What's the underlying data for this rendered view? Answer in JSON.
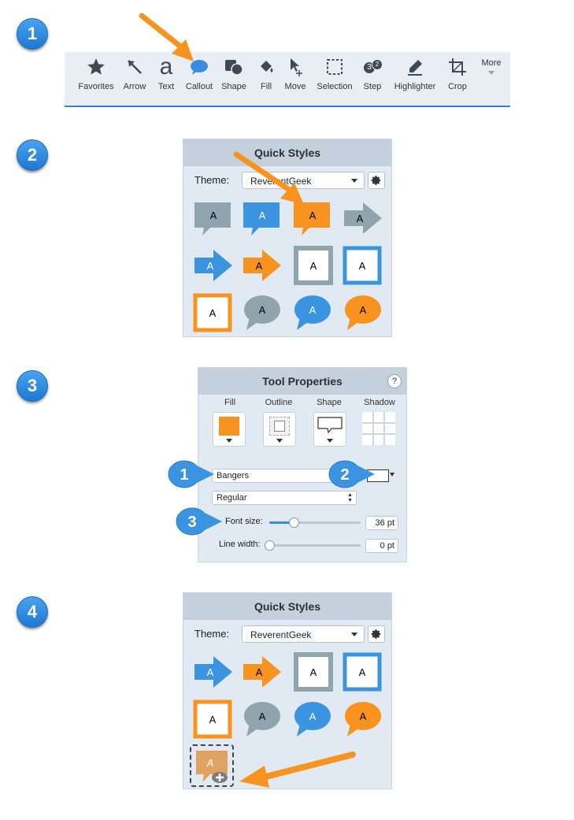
{
  "steps": [
    "1",
    "2",
    "3",
    "4"
  ],
  "colors": {
    "orange": "#f7931e",
    "blue": "#3b94e0",
    "gray": "#90a4ae",
    "accent": "#3a7ed2"
  },
  "toolbar": {
    "items": [
      {
        "label": "Favorites",
        "icon": "star-icon"
      },
      {
        "label": "Arrow",
        "icon": "arrow-icon"
      },
      {
        "label": "Text",
        "icon": "text-icon",
        "glyph": "a"
      },
      {
        "label": "Callout",
        "icon": "callout-icon"
      },
      {
        "label": "Shape",
        "icon": "shape-icon"
      },
      {
        "label": "Fill",
        "icon": "fill-icon"
      },
      {
        "label": "Move",
        "icon": "move-icon"
      },
      {
        "label": "Selection",
        "icon": "selection-icon"
      },
      {
        "label": "Step",
        "icon": "step-icon"
      },
      {
        "label": "Highlighter",
        "icon": "highlighter-icon"
      },
      {
        "label": "Crop",
        "icon": "crop-icon"
      }
    ],
    "more_label": "More",
    "step_icon_nums": [
      "3",
      "2"
    ]
  },
  "quick_styles_top": {
    "title": "Quick Styles",
    "theme_label": "Theme:",
    "theme_value": "ReverentGeek",
    "swatch_letter": "A"
  },
  "tool_properties": {
    "title": "Tool Properties",
    "help": "?",
    "columns": [
      "Fill",
      "Outline",
      "Shape",
      "Shadow"
    ],
    "font": "Bangers",
    "font_style": "Regular",
    "font_size_label": "Font size:",
    "font_size_value": "36 pt",
    "font_size_fraction": 0.27,
    "line_width_label": "Line width:",
    "line_width_value": "0 pt",
    "line_width_fraction": 0.0,
    "callout_nums": [
      "1",
      "2",
      "3"
    ]
  },
  "quick_styles_bottom": {
    "title": "Quick Styles",
    "theme_label": "Theme:",
    "theme_value": "ReverentGeek",
    "swatch_letter": "A"
  }
}
